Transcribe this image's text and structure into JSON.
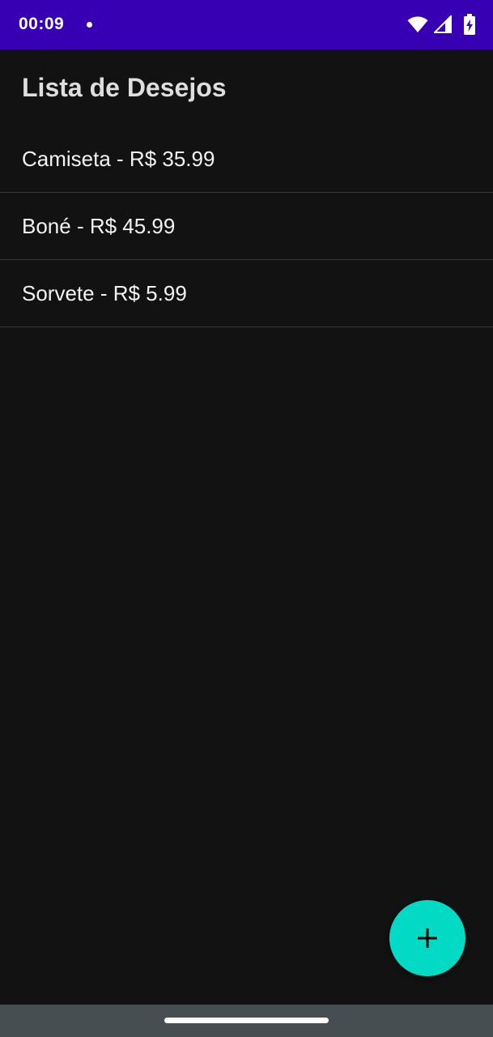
{
  "status_bar": {
    "time": "00:09",
    "background_color": "#3700b3",
    "icons": [
      "notification-dot-icon",
      "wifi-icon",
      "signal-icon",
      "battery-charging-icon"
    ]
  },
  "app": {
    "title": "Lista de Desejos",
    "background_color": "#121212"
  },
  "wish_list": {
    "items": [
      {
        "label": "Camiseta - R$ 35.99"
      },
      {
        "label": "Boné - R$ 45.99"
      },
      {
        "label": "Sorvete - R$ 5.99"
      }
    ]
  },
  "fab": {
    "icon": "plus-icon",
    "color": "#03dac5"
  },
  "nav_bar": {
    "background_color": "#474e52",
    "handle": "home-handle"
  }
}
